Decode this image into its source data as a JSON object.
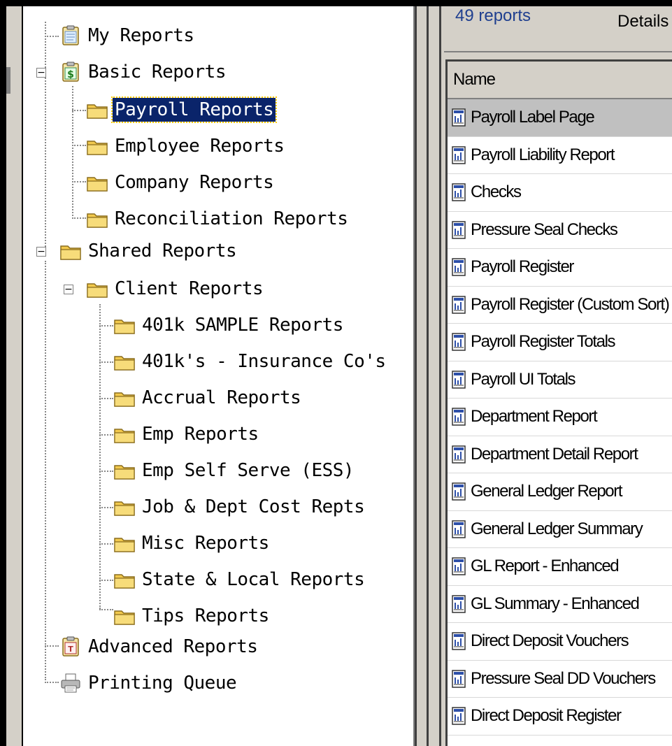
{
  "tree": {
    "my_reports": "My Reports",
    "basic_reports": {
      "label": "Basic Reports",
      "children": [
        "Payroll Reports",
        "Employee Reports",
        "Company Reports",
        "Reconciliation Reports"
      ],
      "selected": "Payroll Reports"
    },
    "shared_reports": {
      "label": "Shared Reports",
      "client_reports": {
        "label": "Client Reports",
        "children": [
          "401k SAMPLE Reports",
          "401k's - Insurance Co's",
          "Accrual Reports",
          "Emp Reports",
          "Emp Self Serve (ESS)",
          "Job & Dept Cost Repts",
          "Misc Reports",
          "State & Local Reports",
          "Tips Reports"
        ]
      }
    },
    "advanced_reports": "Advanced Reports",
    "printing_queue": "Printing Queue"
  },
  "list": {
    "count_label": "49 reports",
    "details_label": "Details",
    "column_name": "Name",
    "rows": [
      "Payroll Label Page",
      "Payroll Liability Report",
      "Checks",
      "Pressure Seal Checks",
      "Payroll Register",
      "Payroll Register (Custom Sort)",
      "Payroll Register Totals",
      "Payroll UI Totals",
      "Department Report",
      "Department Detail Report",
      "General Ledger Report",
      "General Ledger Summary",
      "GL Report - Enhanced",
      "GL Summary - Enhanced",
      "Direct Deposit Vouchers",
      "Pressure Seal DD Vouchers",
      "Direct Deposit Register"
    ],
    "highlighted_row": 0
  },
  "colors": {
    "selection": "#0a246a",
    "folder": "#f2c94c",
    "chrome": "#d4d0c8"
  }
}
